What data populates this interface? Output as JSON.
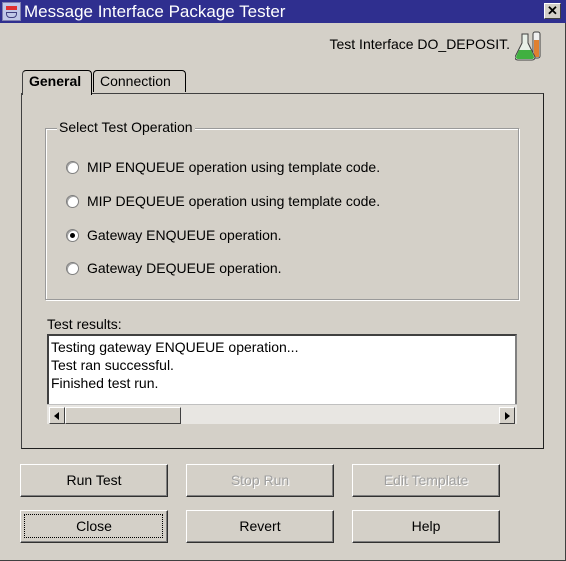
{
  "window": {
    "title": "Message Interface Package Tester",
    "app_icon": "java-coffee-cup-icon",
    "close_glyph": "✕"
  },
  "header": {
    "interface_label": "Test Interface DO_DEPOSIT.",
    "icon": "flask-test-tube-icon"
  },
  "tabs": [
    {
      "label": "General",
      "active": true
    },
    {
      "label": "Connection",
      "active": false
    }
  ],
  "select_operation": {
    "legend": "Select Test Operation",
    "options": [
      {
        "label": "MIP ENQUEUE operation using template code.",
        "checked": false
      },
      {
        "label": "MIP DEQUEUE operation using template code.",
        "checked": false
      },
      {
        "label": "Gateway ENQUEUE operation.",
        "checked": true
      },
      {
        "label": "Gateway DEQUEUE operation.",
        "checked": false
      }
    ]
  },
  "results": {
    "label": "Test results:",
    "lines": [
      "Testing gateway ENQUEUE operation...",
      "Test ran successful.",
      "Finished test run."
    ]
  },
  "buttons": {
    "run_test": {
      "label": "Run Test",
      "enabled": true
    },
    "stop_run": {
      "label": "Stop Run",
      "enabled": false
    },
    "edit_template": {
      "label": "Edit Template",
      "enabled": false
    },
    "close": {
      "label": "Close",
      "enabled": true,
      "focused": true
    },
    "revert": {
      "label": "Revert",
      "enabled": true
    },
    "help": {
      "label": "Help",
      "enabled": true
    }
  },
  "colors": {
    "titlebar": "#2f2f8f",
    "face": "#d4d0c8",
    "disabled_text": "#a0a0a0"
  }
}
